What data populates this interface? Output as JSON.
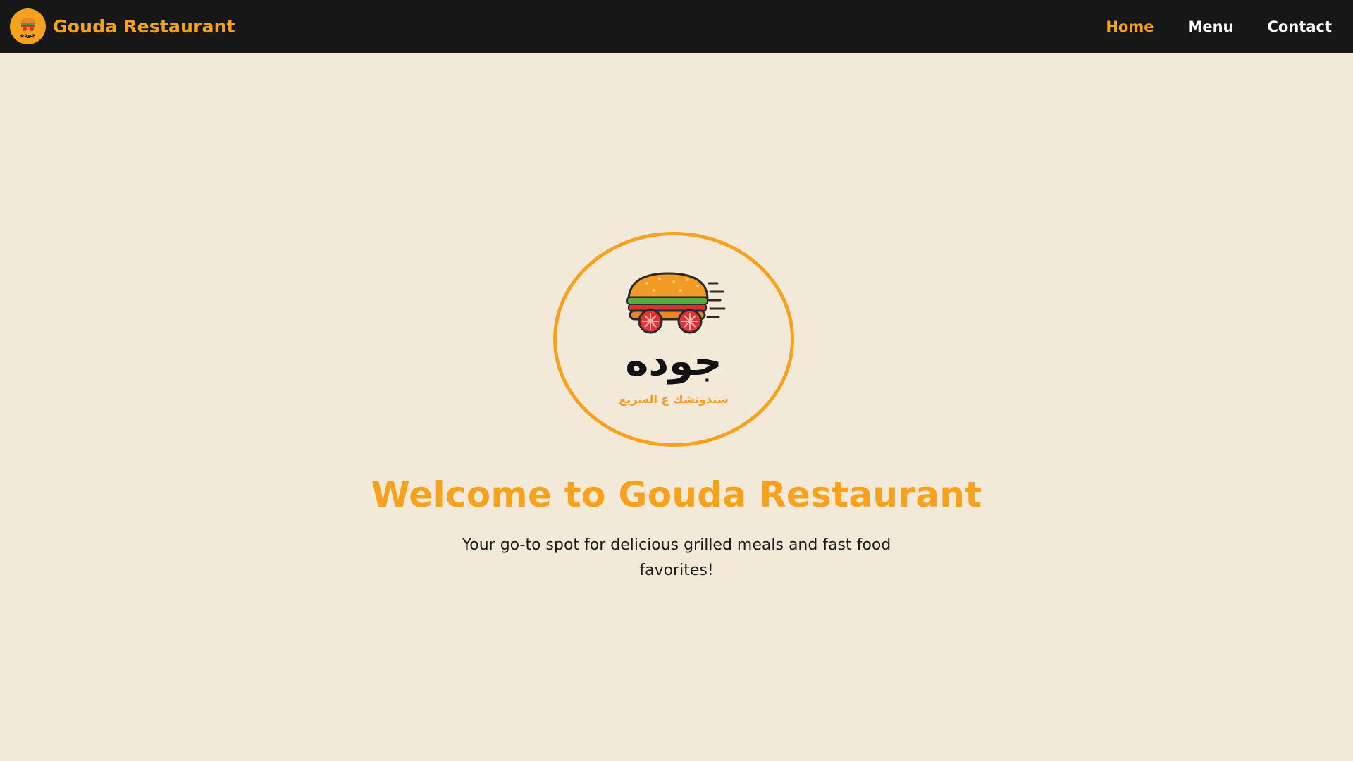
{
  "header": {
    "brand_name": "Gouda Restaurant",
    "logo_icon": "sandwich-logo-icon",
    "nav": [
      {
        "label": "Home",
        "active": true
      },
      {
        "label": "Menu",
        "active": false
      },
      {
        "label": "Contact",
        "active": false
      }
    ]
  },
  "hero": {
    "logo_icon": "sandwich-logo-icon",
    "logo_arabic_name": "جوده",
    "logo_arabic_slogan": "سندوتشك ع السريع",
    "title": "Welcome to Gouda Restaurant",
    "tagline": "Your go-to spot for delicious grilled meals and fast food favorites!"
  },
  "colors": {
    "accent": "#f7a21f",
    "navbar_bg": "#171717",
    "page_bg": "#f2e9d9",
    "text": "#1c1c1c"
  }
}
